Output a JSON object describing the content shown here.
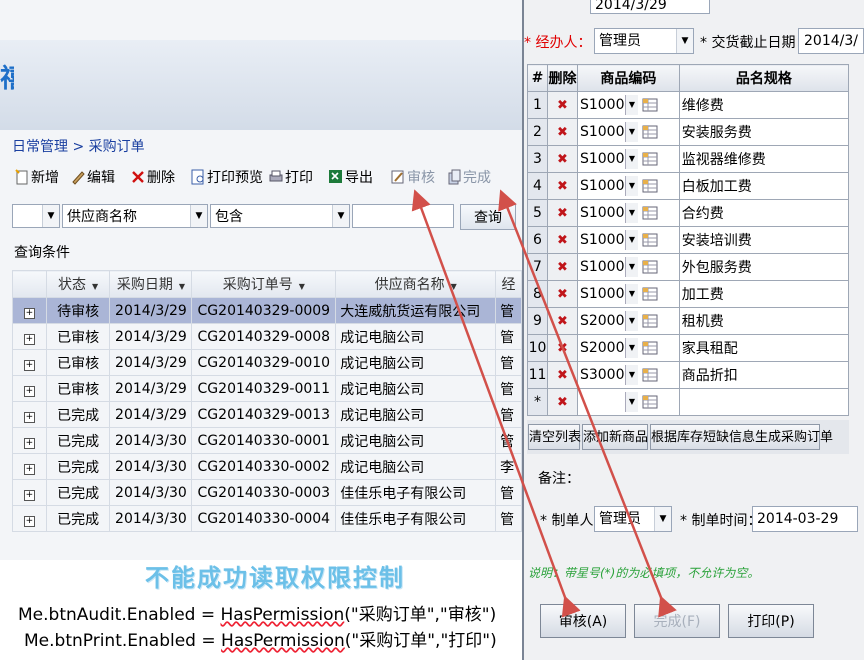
{
  "left": {
    "breadcrumb": "日常管理 > 采购订单",
    "toolbar": {
      "new": "新增",
      "edit": "编辑",
      "delete": "删除",
      "print_preview": "打印预览",
      "print": "打印",
      "export": "导出",
      "audit": "审核",
      "complete": "完成"
    },
    "filter": {
      "field": "供应商名称",
      "operator": "包含",
      "value": "",
      "query_button": "查询"
    },
    "conditions_label": "查询条件",
    "columns": [
      "状态",
      "采购日期",
      "采购订单号",
      "供应商名称",
      "经"
    ],
    "rows": [
      {
        "status": "待审核",
        "date": "2014/3/29",
        "order_no": "CG20140329-0009",
        "supplier": "大连威航货运有限公司",
        "extra": "管"
      },
      {
        "status": "已审核",
        "date": "2014/3/29",
        "order_no": "CG20140329-0008",
        "supplier": "成记电脑公司",
        "extra": "管"
      },
      {
        "status": "已审核",
        "date": "2014/3/29",
        "order_no": "CG20140329-0010",
        "supplier": "成记电脑公司",
        "extra": "管"
      },
      {
        "status": "已审核",
        "date": "2014/3/29",
        "order_no": "CG20140329-0011",
        "supplier": "成记电脑公司",
        "extra": "管"
      },
      {
        "status": "已完成",
        "date": "2014/3/29",
        "order_no": "CG20140329-0013",
        "supplier": "成记电脑公司",
        "extra": "管"
      },
      {
        "status": "已完成",
        "date": "2014/3/30",
        "order_no": "CG20140330-0001",
        "supplier": "成记电脑公司",
        "extra": "管"
      },
      {
        "status": "已完成",
        "date": "2014/3/30",
        "order_no": "CG20140330-0002",
        "supplier": "成记电脑公司",
        "extra": "李"
      },
      {
        "status": "已完成",
        "date": "2014/3/30",
        "order_no": "CG20140330-0003",
        "supplier": "佳佳乐电子有限公司",
        "extra": "管"
      },
      {
        "status": "已完成",
        "date": "2014/3/30",
        "order_no": "CG20140330-0004",
        "supplier": "佳佳乐电子有限公司",
        "extra": "管"
      }
    ]
  },
  "annotation": {
    "caption": "不能成功读取权限控制",
    "code_line1_a": "Me.btnAudit.Enabled = ",
    "code_line1_b": "HasPermission",
    "code_line1_c": "(\"采购订单\",\"审核\")",
    "code_line2_a": "Me.btnPrint.Enabled = ",
    "code_line2_b": "HasPermission",
    "code_line2_c": "(\"采购订单\",\"打印\")"
  },
  "right": {
    "top_partial_date": "2014/3/29",
    "handler_label": "经办人：",
    "handler_value": "管理员",
    "delivery_label": "交货截止日期：",
    "delivery_value": "2014/3/",
    "grid_columns": [
      "#",
      "删除",
      "商品编码",
      "品名规格"
    ],
    "items": [
      {
        "n": "1",
        "code": "S10001",
        "name": "维修费"
      },
      {
        "n": "2",
        "code": "S10002",
        "name": "安装服务费"
      },
      {
        "n": "3",
        "code": "S10003",
        "name": "监视器维修费"
      },
      {
        "n": "4",
        "code": "S10004",
        "name": "白板加工费"
      },
      {
        "n": "5",
        "code": "S10005",
        "name": "合约费"
      },
      {
        "n": "6",
        "code": "S10006",
        "name": "安装培训费"
      },
      {
        "n": "7",
        "code": "S10007",
        "name": "外包服务费"
      },
      {
        "n": "8",
        "code": "S10008",
        "name": "加工费"
      },
      {
        "n": "9",
        "code": "S20001",
        "name": "租机费"
      },
      {
        "n": "10",
        "code": "S20002",
        "name": "家具租配"
      },
      {
        "n": "11",
        "code": "S30001",
        "name": "商品折扣"
      },
      {
        "n": "*",
        "code": "",
        "name": ""
      }
    ],
    "clear_list": "清空列表",
    "add_product": "添加新商品",
    "generate_order": "根据库存短缺信息生成采购订单",
    "remark_label": "备注：",
    "creator_label": "制单人：",
    "creator_value": "管理员",
    "created_time_label": "制单时间：",
    "created_time_value": "2014-03-29",
    "note": "说明：带星号(*)的为必填项，不允许为空。",
    "audit_button": "审核(A)",
    "complete_button": "完成(F)",
    "print_button": "打印(P)"
  },
  "colors": {
    "required": "#e00000",
    "selected_row": "#aab5d6",
    "caption": "#6cc0e8",
    "arrow": "#d2504a"
  },
  "icons": [
    "new-icon",
    "edit-icon",
    "delete-icon",
    "print-preview-icon",
    "print-icon",
    "export-icon",
    "audit-icon",
    "complete-icon",
    "delete-row-icon",
    "lookup-icon"
  ]
}
